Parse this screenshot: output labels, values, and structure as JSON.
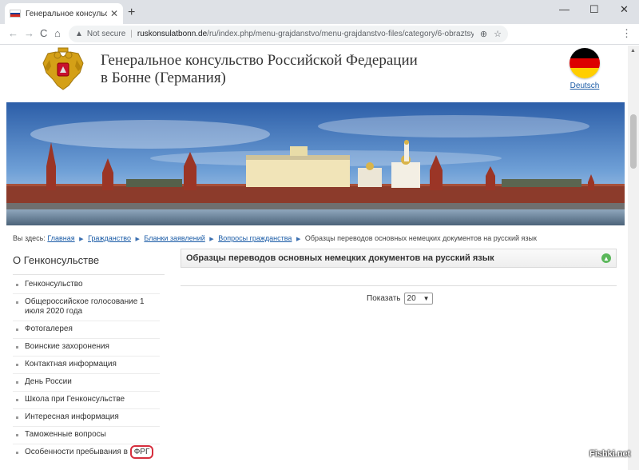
{
  "browser": {
    "tab_title": "Генеральное консульство Росс",
    "tab_close": "✕",
    "new_tab": "+",
    "minimize": "—",
    "maximize": "☐",
    "close": "✕",
    "back": "←",
    "forward": "→",
    "reload": "C",
    "home": "⌂",
    "security_label": "Not secure",
    "url_domain": "ruskonsulatbonn.de",
    "url_path": "/ru/index.php/menu-grajdanstvo/menu-grajdanstvo-files/category/6-obraztsy-perevodov-...",
    "zoom_icon": "⊕",
    "star_icon": "☆",
    "menu_icon": "⋮"
  },
  "header": {
    "title_line1": "Генеральное консульство Российской Федерации",
    "title_line2": "в Бонне (Германия)",
    "lang_link": "Deutsch"
  },
  "breadcrumb": {
    "prefix": "Вы здесь:",
    "items": [
      "Главная",
      "Гражданство",
      "Бланки заявлений",
      "Вопросы гражданства"
    ],
    "current": "Образцы переводов основных немецких документов на русский язык"
  },
  "sidebar": {
    "title": "О Генконсульстве",
    "items": [
      {
        "label": "Генконсульство"
      },
      {
        "label": "Общероссийское голосование 1 июля 2020 года"
      },
      {
        "label": "Фотогалерея"
      },
      {
        "label": "Воинские захоронения"
      },
      {
        "label": "Контактная информация"
      },
      {
        "label": "День России"
      },
      {
        "label": "Школа при Генконсульстве"
      },
      {
        "label": "Интересная информация"
      },
      {
        "label": "Таможенные вопросы"
      }
    ],
    "last_item_a": "Особенности пребывания в",
    "last_item_b": "ФРГ"
  },
  "main": {
    "heading": "Образцы переводов основных немецких документов на русский язык",
    "show_label": "Показать",
    "show_value": "20"
  },
  "watermark": "Fishki.net",
  "colors": {
    "link": "#1a5ba6",
    "highlight": "#d62e3d",
    "accent_green": "#5cb85c"
  }
}
